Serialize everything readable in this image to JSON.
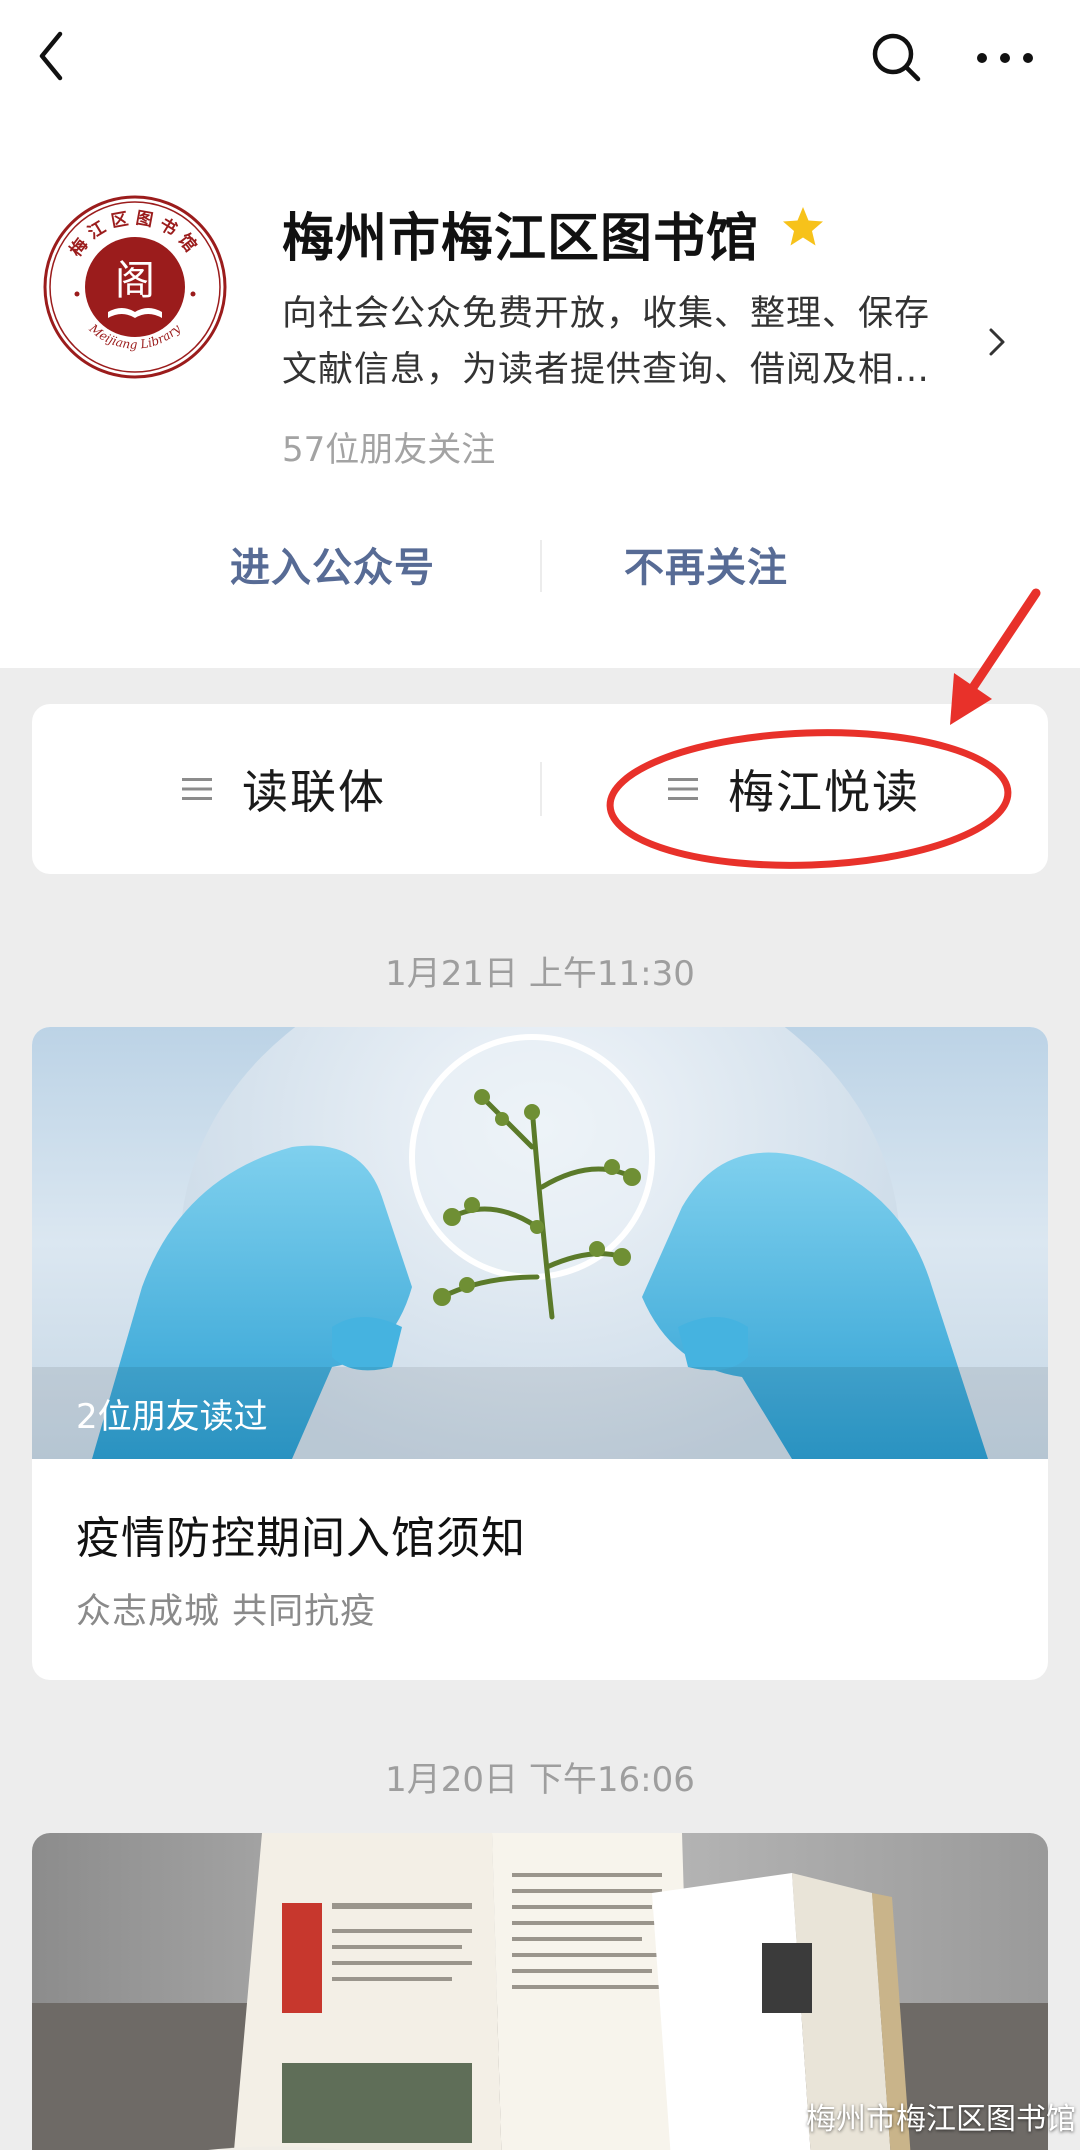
{
  "account": {
    "name": "梅州市梅江区图书馆",
    "logo_text_top": "梅江区图书馆",
    "logo_text_bottom": "Meijiang Library",
    "description_line1": "向社会公众免费开放，收集、整理、保存",
    "description_line2": "文献信息，为读者提供查询、借阅及相…",
    "followers": "57位朋友关注"
  },
  "actions": {
    "enter": "进入公众号",
    "unfollow": "不再关注"
  },
  "menu": {
    "items": [
      {
        "label": "读联体"
      },
      {
        "label": "梅江悦读"
      }
    ]
  },
  "articles": [
    {
      "timestamp": "1月21日 上午11:30",
      "read_by": "2位朋友读过",
      "title": "疫情防控期间入馆须知",
      "summary": "众志成城  共同抗疫"
    },
    {
      "timestamp": "1月20日 下午16:06"
    }
  ],
  "watermark": "梅州市梅江区图书馆",
  "colors": {
    "link": "#576b95",
    "star": "#f7c21a",
    "annotation": "#e8312a",
    "logo": "#9b1c1c"
  },
  "icons": [
    "back-icon",
    "search-icon",
    "more-icon",
    "star-icon",
    "chevron-right-icon",
    "menu-list-icon",
    "wechat-icon"
  ]
}
